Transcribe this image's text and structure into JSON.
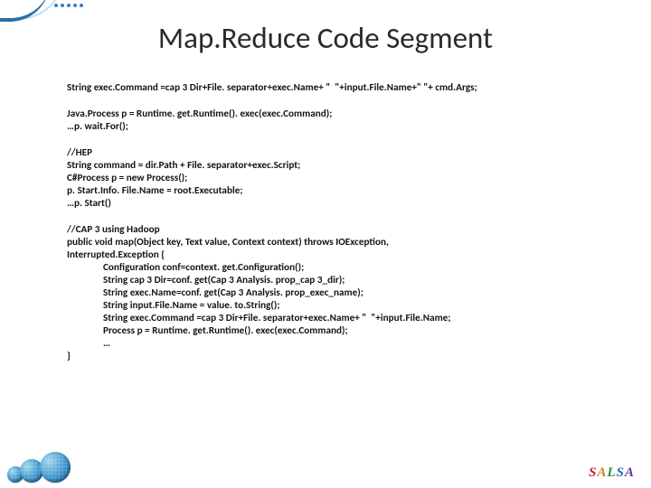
{
  "title": "Map.Reduce Code Segment",
  "code": {
    "line1": "String exec.Command =cap 3 Dir+File. separator+exec.Name+ \"  \"+input.File.Name+\" \"+ cmd.Args;",
    "block2a": "Java.Process p = Runtime. get.Runtime(). exec(exec.Command);",
    "block2b": "…p. wait.For();",
    "block3a": "//HEP",
    "block3b": "String command = dir.Path + File. separator+exec.Script;",
    "block3c": "C#Process p = new Process();",
    "block3d": "p. Start.Info. File.Name = root.Executable;",
    "block3e": "…p. Start()",
    "block4a": "//CAP 3 using Hadoop",
    "block4b": "public void map(Object key, Text value, Context context) throws IOException,",
    "block4c": "Interrupted.Exception {",
    "block4d": "Configuration conf=context. get.Configuration();",
    "block4e": "String cap 3 Dir=conf. get(Cap 3 Analysis. prop_cap 3_dir);",
    "block4f": "String exec.Name=conf. get(Cap 3 Analysis. prop_exec_name);",
    "block4g": "String input.File.Name = value. to.String();",
    "block4h": "String exec.Command =cap 3 Dir+File. separator+exec.Name+ \"  \"+input.File.Name;",
    "block4i": "Process p = Runtime. get.Runtime(). exec(exec.Command);",
    "block4j": "…",
    "block4k": "}"
  },
  "footer": {
    "brand_letters": [
      "S",
      "A",
      "L",
      "S",
      "A"
    ]
  }
}
